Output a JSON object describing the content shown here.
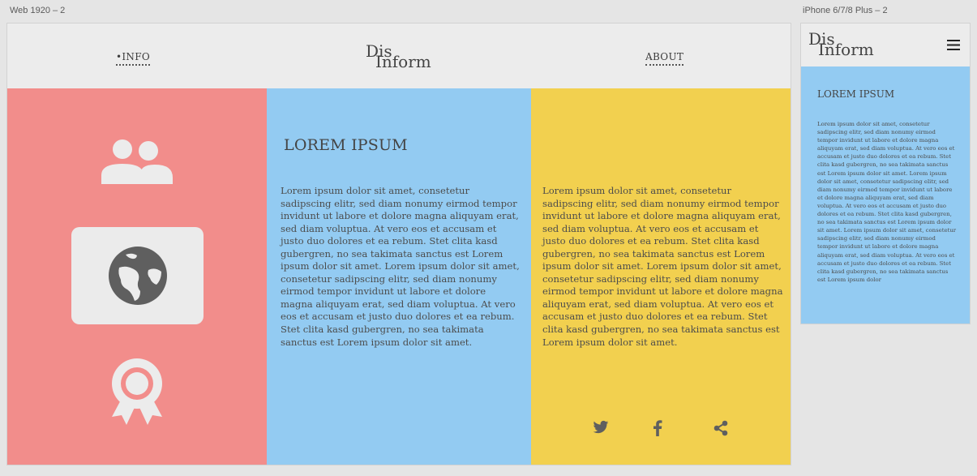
{
  "artboards": {
    "web_label": "Web 1920 – 2",
    "phone_label": "iPhone 6/7/8 Plus – 2"
  },
  "brand": {
    "line1": "Dis",
    "line2": "Inform"
  },
  "nav": {
    "info": "•INFO",
    "about": "ABOUT"
  },
  "main": {
    "heading": "LOREM IPSUM",
    "body": "Lorem ipsum dolor sit amet, consetetur sadipscing elitr, sed diam nonumy eirmod tempor invidunt ut labore et dolore magna aliquyam erat, sed diam voluptua. At vero eos et accusam et justo duo dolores et ea rebum. Stet clita kasd gubergren, no sea takimata sanctus est Lorem ipsum dolor sit amet. Lorem ipsum dolor sit amet, consetetur sadipscing elitr, sed diam nonumy eirmod tempor invidunt ut labore et dolore magna aliquyam erat, sed diam voluptua. At vero eos et accusam et justo duo dolores et ea rebum. Stet clita kasd gubergren, no sea takimata sanctus est Lorem ipsum dolor sit amet."
  },
  "side": {
    "body": "Lorem ipsum dolor sit amet, consetetur sadipscing elitr, sed diam nonumy eirmod tempor invidunt ut labore et dolore magna aliquyam erat, sed diam voluptua. At vero eos et accusam et justo duo dolores et ea rebum. Stet clita kasd gubergren, no sea takimata sanctus est Lorem ipsum dolor sit amet. Lorem ipsum dolor sit amet, consetetur sadipscing elitr, sed diam nonumy eirmod tempor invidunt ut labore et dolore magna aliquyam erat, sed diam voluptua. At vero eos et accusam et justo duo dolores et ea rebum. Stet clita kasd gubergren, no sea takimata sanctus est Lorem ipsum dolor sit amet."
  },
  "phone": {
    "heading": "LOREM IPSUM",
    "body": "Lorem ipsum dolor sit amet, consetetur sadipscing elitr, sed diam nonumy eirmod tempor invidunt ut labore et dolore magna aliquyam erat, sed diam voluptua. At vero eos et accusam et justo duo dolores et ea rebum. Stet clita kasd gubergren, no sea takimata sanctus est Lorem ipsum dolor sit amet. Lorem ipsum dolor sit amet, consetetur sadipscing elitr, sed diam nonumy eirmod tempor invidunt ut labore et dolore magna aliquyam erat, sed diam voluptua. At vero eos et accusam et justo duo dolores et ea rebum. Stet clita kasd gubergren, no sea takimata sanctus est Lorem ipsum dolor sit amet. Lorem ipsum dolor sit amet, consetetur sadipscing elitr, sed diam nonumy eirmod tempor invidunt ut labore et dolore magna aliquyam erat, sed diam voluptua. At vero eos et accusam et justo duo dolores et ea rebum. Stet clita kasd gubergren, no sea takimata sanctus est Lorem ipsum dolor"
  },
  "icons": {
    "people": "people-icon",
    "globe": "globe-icon",
    "award": "award-icon",
    "twitter": "twitter-icon",
    "facebook": "facebook-icon",
    "share": "share-icon",
    "menu": "hamburger-menu-icon"
  },
  "colors": {
    "canvas": "#e5e5e5",
    "header": "#ececec",
    "coral": "#f28d8b",
    "sky": "#93cbf2",
    "mustard": "#f2d04f",
    "text": "#4c4c4c",
    "icon_light": "#ececec",
    "icon_dark": "#5f5f5f"
  }
}
